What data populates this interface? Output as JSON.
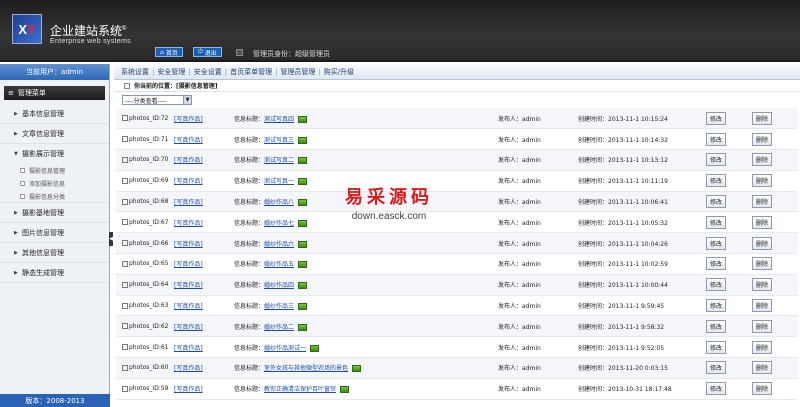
{
  "header": {
    "title": "企业建站系统",
    "title_reg": "®",
    "subtitle": "Enterprise web systems",
    "home_label": "首页",
    "logout_label": "退出",
    "admin_text": "管理员身份：超级管理员",
    "logo_text_1": "X",
    "logo_text_2": "Y"
  },
  "sidebar": {
    "head": "当前用户：admin",
    "menu_title": "管理菜单",
    "groups": [
      {
        "label": "基本信息管理"
      },
      {
        "label": "文章信息管理"
      },
      {
        "label": "摄影展示管理"
      },
      {
        "label": "摄影基地管理"
      },
      {
        "label": "图片信息管理"
      },
      {
        "label": "其他信息管理"
      },
      {
        "label": "静态生成管理"
      }
    ],
    "subitems": [
      "摄影信息管理",
      "添加摄影信息",
      "摄影信息分类"
    ],
    "footer": "版本：2008-2013"
  },
  "nav": [
    "系统设置",
    "安全管理",
    "安全设置",
    "首页菜单管理",
    "管理员管理",
    "购买/升级"
  ],
  "location": "你当前的位置：[摄影信息管理]",
  "filter": {
    "selected": "----分类查看----"
  },
  "labels": {
    "title_prefix": "信息标题：",
    "publisher": "发布人：",
    "created": "创建时间：",
    "edit": "修改",
    "delete": "删除"
  },
  "rows": [
    {
      "id": "photos_ID:72",
      "cat": "[写真作品]",
      "title": "测试写真四",
      "user": "admin",
      "time": "2013-11-1 10:15:24"
    },
    {
      "id": "photos_ID:71",
      "cat": "[写真作品]",
      "title": "测试写真三",
      "user": "admin",
      "time": "2013-11-1 10:14:32"
    },
    {
      "id": "photos_ID:70",
      "cat": "[写真作品]",
      "title": "测试写真二",
      "user": "admin",
      "time": "2013-11-1 10:13:12"
    },
    {
      "id": "photos_ID:69",
      "cat": "[写真作品]",
      "title": "测试写真一",
      "user": "admin",
      "time": "2013-11-1 10:11:19"
    },
    {
      "id": "photos_ID:68",
      "cat": "[写真作品]",
      "title": "婚纱作品八",
      "user": "admin",
      "time": "2013-11-1 10:06:41"
    },
    {
      "id": "photos_ID:67",
      "cat": "[写真作品]",
      "title": "婚纱作品七",
      "user": "admin",
      "time": "2013-11-1 10:05:32"
    },
    {
      "id": "photos_ID:66",
      "cat": "[写真作品]",
      "title": "婚纱作品六",
      "user": "admin",
      "time": "2013-11-1 10:04:26"
    },
    {
      "id": "photos_ID:65",
      "cat": "[写真作品]",
      "title": "婚纱作品五",
      "user": "admin",
      "time": "2013-11-1 10:02:59"
    },
    {
      "id": "photos_ID:64",
      "cat": "[写真作品]",
      "title": "婚纱作品四",
      "user": "admin",
      "time": "2013-11-1 10:00:44"
    },
    {
      "id": "photos_ID:63",
      "cat": "[写真作品]",
      "title": "婚纱作品三",
      "user": "admin",
      "time": "2013-11-1 9:59:45"
    },
    {
      "id": "photos_ID:62",
      "cat": "[写真作品]",
      "title": "婚纱作品二",
      "user": "admin",
      "time": "2013-11-1 9:58:32"
    },
    {
      "id": "photos_ID:61",
      "cat": "[写真作品]",
      "title": "婚纱作品测试一",
      "user": "admin",
      "time": "2013-11-1 9:52:05"
    },
    {
      "id": "photos_ID:60",
      "cat": "[写真作品]",
      "title": "室外女孩与其他微型农场的景色",
      "user": "admin",
      "time": "2013-11-20 0:03:15"
    },
    {
      "id": "photos_ID:59",
      "cat": "[写真作品]",
      "title": "教你正确清洁保护百叶窗帘",
      "user": "admin",
      "time": "2013-10-31 18:17:48"
    }
  ],
  "watermark": {
    "cn": "易采源码",
    "url": "down.easck.com"
  },
  "colors": {
    "header_bg": "#2a2a2a",
    "accent": "#2a63b5",
    "link": "#1b4fa8",
    "watermark": "#d81c1c"
  }
}
